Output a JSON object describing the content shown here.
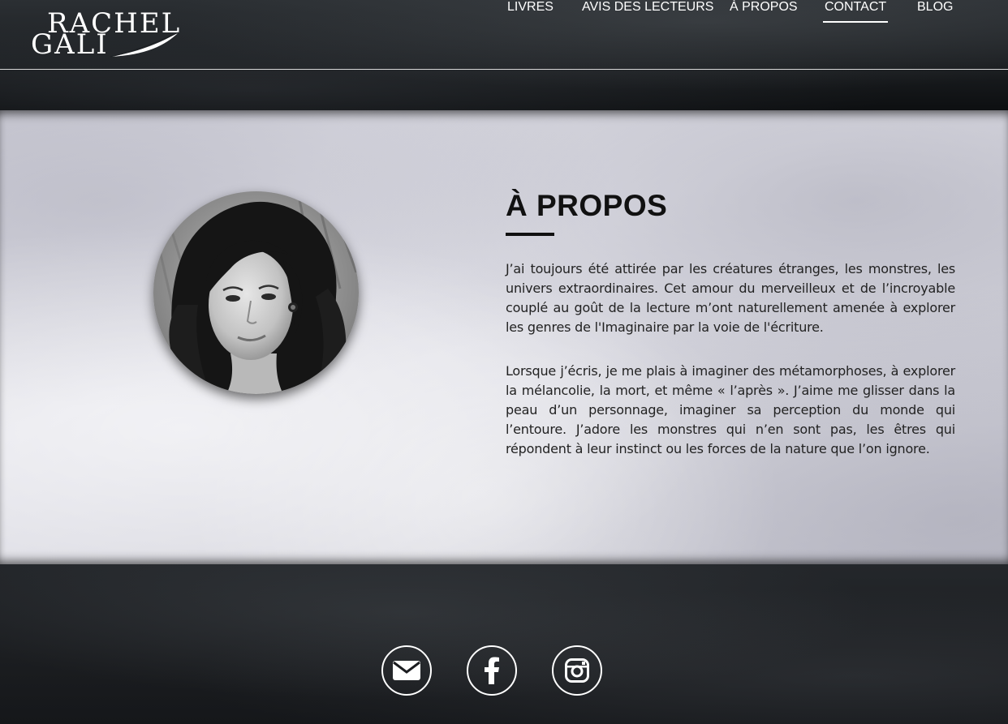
{
  "brand": {
    "line1": "RACHEL",
    "line2": "GALI"
  },
  "nav": {
    "items": [
      {
        "label": "LIVRES"
      },
      {
        "label": "AVIS DES LECTEURS"
      },
      {
        "label": "À PROPOS"
      },
      {
        "label": "CONTACT",
        "active": true
      },
      {
        "label": "BLOG"
      }
    ]
  },
  "about": {
    "title": "À PROPOS",
    "paragraphs": [
      "J’ai toujours été attirée par les créatures étranges, les monstres, les univers extraordinaires. Cet amour du merveilleux et de l’incroyable couplé au goût de la lecture m’ont naturellement amenée à explorer les genres de l'Imaginaire par la voie de l'écriture.",
      "Lorsque j’écris, je me plais à imaginer des métamorphoses, à explorer la mélancolie, la mort, et même « l’après ». J’aime me glisser dans la peau d’un personnage, imaginer sa perception du monde qui l’entoure. J’adore les monstres qui n’en sont pas, les êtres qui répondent à leur instinct ou les forces de la nature que l’on ignore."
    ]
  },
  "social": [
    {
      "icon": "envelope-icon"
    },
    {
      "icon": "facebook-icon"
    },
    {
      "icon": "instagram-icon"
    }
  ],
  "colors": {
    "header_bg": "#1c1f22",
    "about_bg": "#dcdce3",
    "text_dark": "#111111",
    "footer_bg": "#1b1d20",
    "white": "#ffffff"
  }
}
